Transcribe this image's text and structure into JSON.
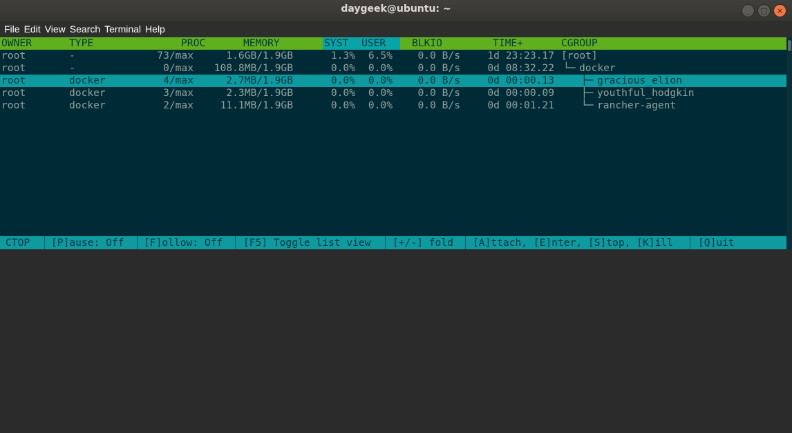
{
  "window": {
    "title": "daygeek@ubuntu: ~",
    "controls": [
      "_",
      "□",
      "×"
    ]
  },
  "menu": [
    "File",
    "Edit",
    "View",
    "Search",
    "Terminal",
    "Help"
  ],
  "header": {
    "owner": "OWNER",
    "type": "TYPE",
    "proc": "PROC",
    "memory": "MEMORY",
    "syst": "SYST",
    "user": "USER",
    "blkio": "BLKIO",
    "time": "TIME+",
    "cgroup": "CGROUP"
  },
  "rows": [
    {
      "owner": "root",
      "type": "-",
      "proc": "73/max",
      "memory": "1.6GB/1.9GB",
      "syst": "1.3%",
      "user": "6.5%",
      "blkio": "0.0 B/s",
      "time": "1d 23:23.17",
      "tree": "",
      "cgroup": "[root]"
    },
    {
      "owner": "root",
      "type": "-",
      "proc": "0/max",
      "memory": "108.8MB/1.9GB",
      "syst": "0.0%",
      "user": "0.0%",
      "blkio": "0.0 B/s",
      "time": "0d 08:32.22",
      "tree": "└─",
      "cgroup": "docker"
    },
    {
      "owner": "root",
      "type": "docker",
      "proc": "4/max",
      "memory": "2.7MB/1.9GB",
      "syst": "0.0%",
      "user": "0.0%",
      "blkio": "0.0 B/s",
      "time": "0d 00:00.13",
      "tree": "├─",
      "cgroup": "gracious_elion"
    },
    {
      "owner": "root",
      "type": "docker",
      "proc": "3/max",
      "memory": "2.3MB/1.9GB",
      "syst": "0.0%",
      "user": "0.0%",
      "blkio": "0.0 B/s",
      "time": "0d 00:00.09",
      "tree": "├─",
      "cgroup": "youthful_hodgkin"
    },
    {
      "owner": "root",
      "type": "docker",
      "proc": "2/max",
      "memory": "11.1MB/1.9GB",
      "syst": "0.0%",
      "user": "0.0%",
      "blkio": "0.0 B/s",
      "time": "0d 00:01.21",
      "tree": "└─",
      "cgroup": "rancher-agent"
    }
  ],
  "status": [
    "CTOP",
    "[P]ause: Off",
    "[F]ollow: Off",
    "[F5] Toggle list view",
    "[+/-] fold",
    "[A]ttach, [E]nter, [S]top, [K]ill",
    "[Q]uit"
  ],
  "colors": {
    "background": "#002b36",
    "header": "#5faf1f",
    "highlight": "#0f9aa0",
    "text": "#93a1a1"
  }
}
